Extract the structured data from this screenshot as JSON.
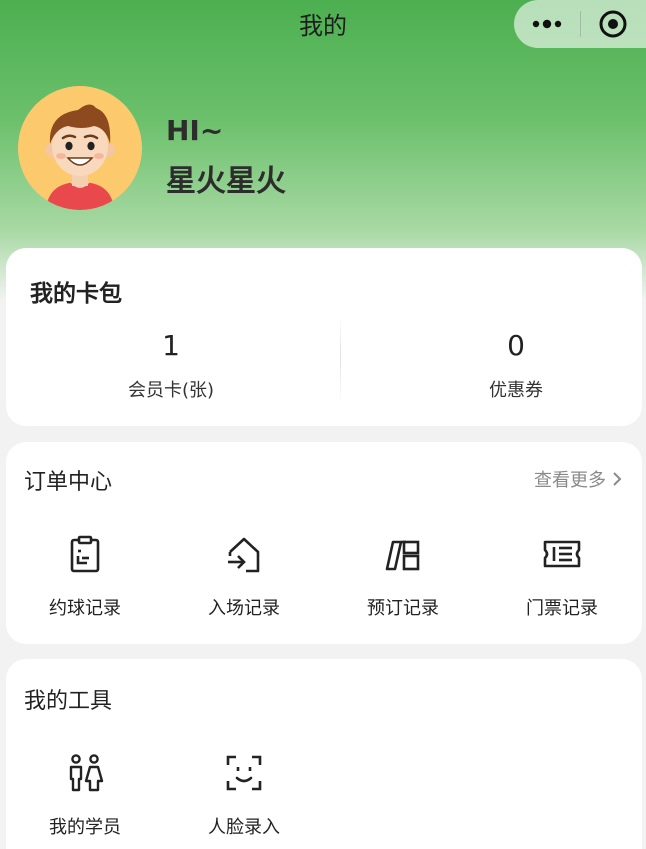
{
  "nav": {
    "title": "我的",
    "more_icon": "more-dots-icon",
    "close_icon": "target-circle-icon"
  },
  "profile": {
    "greeting": "HI~",
    "nickname": "星火星火"
  },
  "wallet": {
    "title": "我的卡包",
    "items": [
      {
        "value": "1",
        "label": "会员卡(张)"
      },
      {
        "value": "0",
        "label": "优惠券"
      }
    ]
  },
  "orders": {
    "title": "订单中心",
    "more": "查看更多",
    "items": [
      {
        "label": "约球记录",
        "icon": "clipboard-icon"
      },
      {
        "label": "入场记录",
        "icon": "enter-house-icon"
      },
      {
        "label": "预订记录",
        "icon": "booking-cards-icon"
      },
      {
        "label": "门票记录",
        "icon": "ticket-icon"
      }
    ]
  },
  "tools": {
    "title": "我的工具",
    "items": [
      {
        "label": "我的学员",
        "icon": "students-icon"
      },
      {
        "label": "人脸录入",
        "icon": "face-scan-icon"
      }
    ]
  },
  "colors": {
    "header_green": "#4caf50",
    "background": "#f1f2f1",
    "card": "#ffffff",
    "avatar_bg": "#fcca6d"
  }
}
